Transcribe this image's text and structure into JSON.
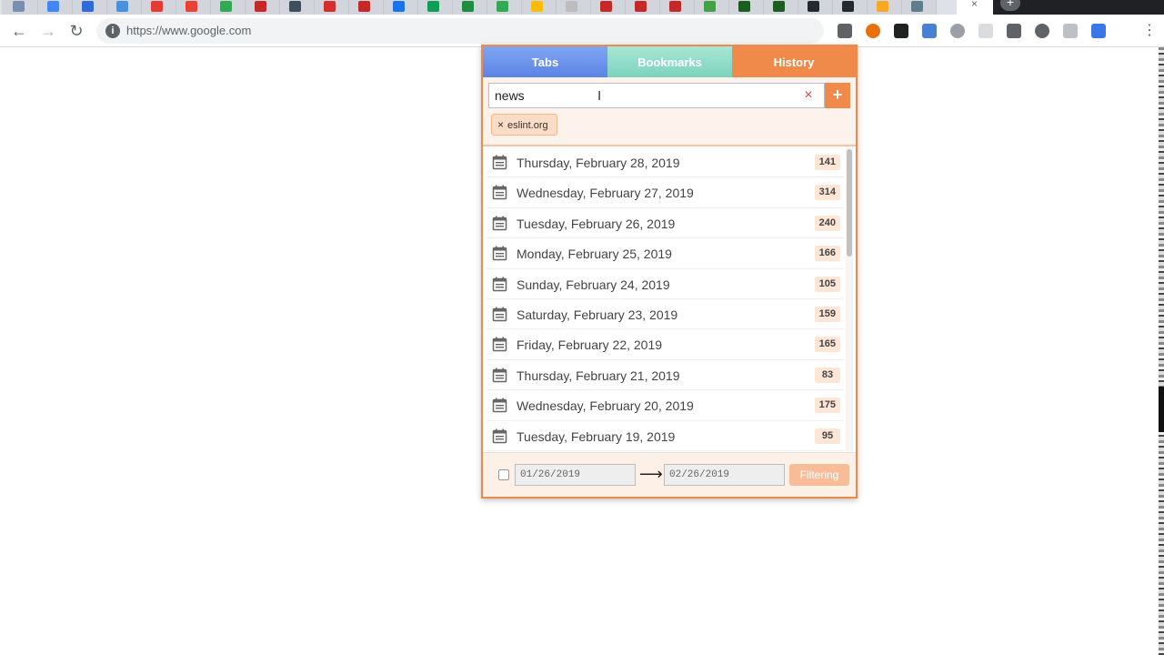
{
  "browser": {
    "tab_colors": [
      "#7a8fb0",
      "#4285f4",
      "#2d6bd8",
      "#4a8fe0",
      "#e53935",
      "#ea4335",
      "#34a853",
      "#c62828",
      "#3d4f5c",
      "#d32f2f",
      "#c62828",
      "#1a73e8",
      "#0f9d58",
      "#1e8e3e",
      "#34a853",
      "#fbbc05",
      "#bdbdbd",
      "#c62828",
      "#c62828",
      "#c62828",
      "#43a047",
      "#1b5e20",
      "#1b5e20",
      "#24292e",
      "#24292e",
      "#f9a825",
      "#607d8b"
    ],
    "tab_close": "×",
    "new_tab": "+",
    "url": "https://www.google.com",
    "nav": {
      "back": "←",
      "forward": "→",
      "reload": "↻",
      "site_info": "i"
    },
    "menu": "⋮",
    "extension_colors": [
      "#5f6368",
      "#e8710a",
      "#202124",
      "#4a7fd6",
      "#9aa0a6",
      "#dadce0",
      "#5f6368",
      "#5f6368",
      "#bdc1c6",
      "#3b78e7"
    ]
  },
  "popup": {
    "tabs": {
      "tabs": "Tabs",
      "bookmarks": "Bookmarks",
      "history": "History"
    },
    "search": {
      "value": "news",
      "clear": "×",
      "add": "+"
    },
    "chip": {
      "remove": "×",
      "label": "eslint.org"
    },
    "days": [
      {
        "label": "Thursday, February 28, 2019",
        "count": "141"
      },
      {
        "label": "Wednesday, February 27, 2019",
        "count": "314"
      },
      {
        "label": "Tuesday, February 26, 2019",
        "count": "240"
      },
      {
        "label": "Monday, February 25, 2019",
        "count": "166"
      },
      {
        "label": "Sunday, February 24, 2019",
        "count": "105"
      },
      {
        "label": "Saturday, February 23, 2019",
        "count": "159"
      },
      {
        "label": "Friday, February 22, 2019",
        "count": "165"
      },
      {
        "label": "Thursday, February 21, 2019",
        "count": "83"
      },
      {
        "label": "Wednesday, February 20, 2019",
        "count": "175"
      },
      {
        "label": "Tuesday, February 19, 2019",
        "count": "95"
      }
    ],
    "footer": {
      "date_from": "01/26/2019",
      "arrow": "⟶",
      "date_to": "02/26/2019",
      "filter": "Filtering"
    }
  },
  "colors": {
    "accent": "#f08a4b",
    "tabs_tab": "#5b84e4",
    "bookmarks_tab": "#7dd3bd"
  }
}
